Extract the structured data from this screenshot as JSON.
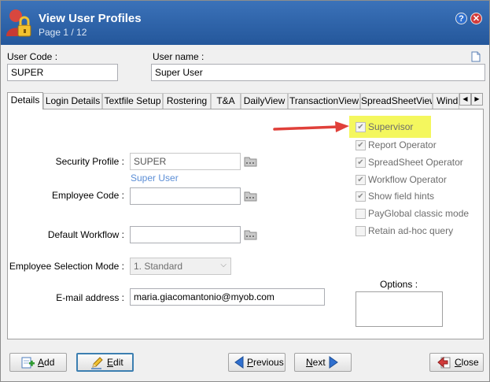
{
  "window": {
    "title": "View User Profiles",
    "page_indicator": "Page 1 / 12",
    "help_glyph": "?",
    "close_glyph": "✕"
  },
  "header": {
    "user_code_label": "User Code :",
    "user_code_value": "SUPER",
    "user_name_label": "User name :",
    "user_name_value": "Super User"
  },
  "tabs": [
    {
      "label": "Details",
      "active": true
    },
    {
      "label": "Login Details"
    },
    {
      "label": "Textfile Setup"
    },
    {
      "label": "Rostering"
    },
    {
      "label": "T&A"
    },
    {
      "label": "DailyView"
    },
    {
      "label": "TransactionView"
    },
    {
      "label": "SpreadSheetView"
    },
    {
      "label": "Wind"
    }
  ],
  "tab_scroll": {
    "left": "◀",
    "right": "▶"
  },
  "details": {
    "security_profile_label": "Security Profile :",
    "security_profile_value": "SUPER",
    "security_profile_hint": "Super User",
    "employee_code_label": "Employee Code :",
    "employee_code_value": "",
    "default_workflow_label": "Default Workflow :",
    "default_workflow_value": "",
    "employee_selection_mode_label": "Employee Selection Mode :",
    "employee_selection_mode_value": "1. Standard",
    "email_label": "E-mail address :",
    "email_value": "maria.giacomantonio@myob.com",
    "options_label": "Options :"
  },
  "checkboxes": [
    {
      "label": "Supervisor",
      "checked": true,
      "highlighted": true
    },
    {
      "label": "Report Operator",
      "checked": true
    },
    {
      "label": "SpreadSheet Operator",
      "checked": true
    },
    {
      "label": "Workflow Operator",
      "checked": true
    },
    {
      "label": "Show field hints",
      "checked": true
    },
    {
      "label": "PayGlobal classic mode",
      "checked": false
    },
    {
      "label": "Retain ad-hoc query",
      "checked": false
    }
  ],
  "check_glyph": "✔",
  "buttons": {
    "add": {
      "mnemonic": "A",
      "rest": "dd"
    },
    "edit": {
      "mnemonic": "E",
      "rest": "dit"
    },
    "previous": {
      "mnemonic": "P",
      "rest": "revious"
    },
    "next": {
      "mnemonic": "N",
      "rest": "ext"
    },
    "close": {
      "mnemonic": "C",
      "rest": "lose"
    }
  },
  "colors": {
    "title_bar": "#24579b",
    "highlight": "#f4f75e",
    "annotation_arrow": "#e0403a",
    "hint_text": "#5b8ed6"
  }
}
